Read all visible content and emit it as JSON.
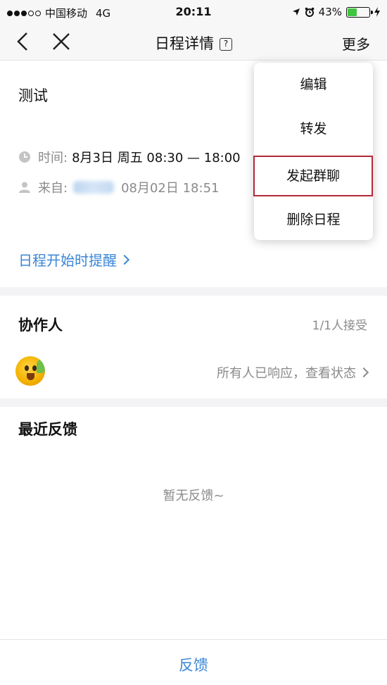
{
  "status_bar": {
    "carrier": "中国移动",
    "network": "4G",
    "time": "20:11",
    "battery_percent": "43%",
    "battery_level": 0.43
  },
  "nav": {
    "title": "日程详情",
    "more_label": "更多",
    "help_glyph": "?"
  },
  "event": {
    "title": "测试",
    "time_label": "时间:",
    "time_value": "8月3日 周五 08:30 — 18:00",
    "from_label": "来自:",
    "from_date": "08月02日 18:51"
  },
  "reminder_label": "日程开始时提醒",
  "collaborators": {
    "title": "协作人",
    "count": "1/1人接受",
    "status_link": "所有人已响应，查看状态"
  },
  "feedback_section": {
    "title": "最近反馈",
    "empty_text": "暂无反馈~"
  },
  "bottom": {
    "feedback_button": "反馈"
  },
  "menu": {
    "items": [
      {
        "label": "编辑"
      },
      {
        "label": "转发"
      },
      {
        "label": "发起群聊"
      },
      {
        "label": "删除日程"
      }
    ],
    "highlight_color": "#b3283a"
  },
  "colors": {
    "link_blue": "#3a86d6",
    "muted_gray": "#8a8a8a"
  }
}
